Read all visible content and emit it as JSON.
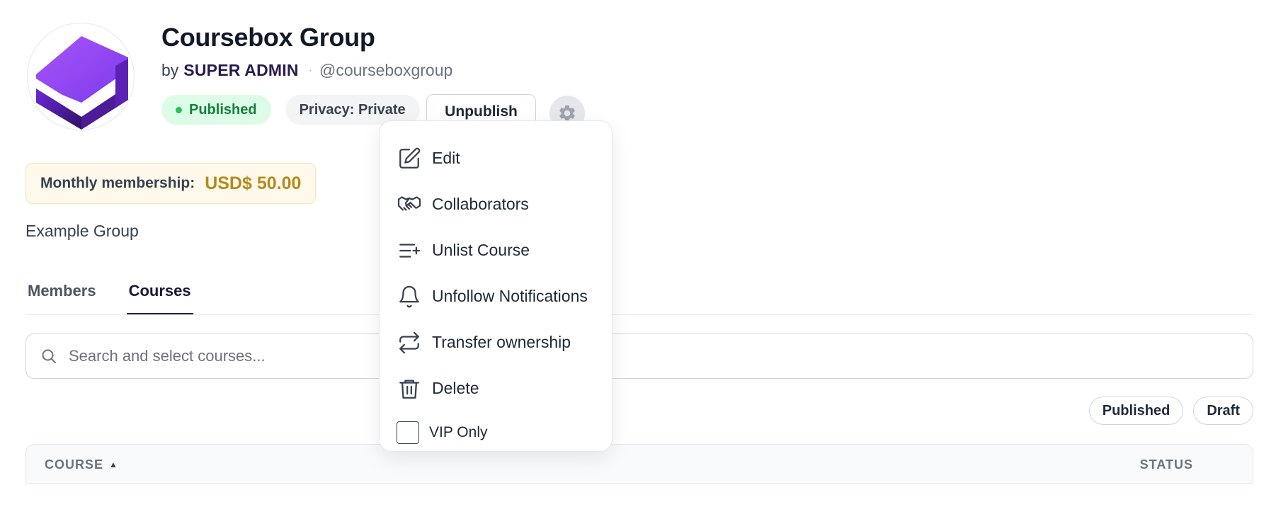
{
  "group": {
    "title": "Coursebox Group",
    "by_prefix": "by",
    "author": "SUPER ADMIN",
    "separator": "·",
    "handle": "@courseboxgroup",
    "status_badge": "Published",
    "privacy_badge": "Privacy: Private",
    "unpublish_label": "Unpublish",
    "membership_label": "Monthly membership:",
    "membership_price": "USD$ 50.00",
    "description": "Example Group"
  },
  "tabs": [
    {
      "label": "Members",
      "active": false
    },
    {
      "label": "Courses",
      "active": true
    }
  ],
  "search": {
    "placeholder": "Search and select courses..."
  },
  "filters": [
    {
      "label": "Published"
    },
    {
      "label": "Draft"
    }
  ],
  "table": {
    "columns": [
      {
        "label": "COURSE",
        "sort": "▲"
      },
      {
        "label": "STATUS"
      }
    ]
  },
  "dropdown": {
    "items": [
      {
        "label": "Edit",
        "icon": "edit-icon"
      },
      {
        "label": "Collaborators",
        "icon": "handshake-icon"
      },
      {
        "label": "Unlist Course",
        "icon": "list-plus-icon"
      },
      {
        "label": "Unfollow Notifications",
        "icon": "bell-icon"
      },
      {
        "label": "Transfer ownership",
        "icon": "transfer-icon"
      },
      {
        "label": "Delete",
        "icon": "trash-icon"
      }
    ],
    "vip_label": "VIP Only",
    "vip_checked": false
  },
  "colors": {
    "logo_purple": "#8b3ff0",
    "published_green": "#15803d",
    "price_gold": "#b58a1d",
    "active_tab": "#2a1b4e"
  }
}
